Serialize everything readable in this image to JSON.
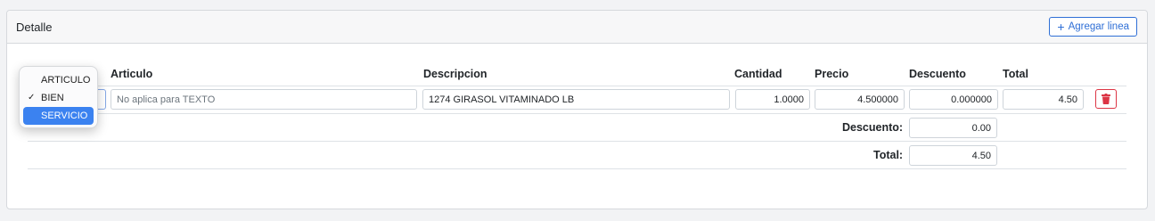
{
  "header": {
    "title": "Detalle",
    "add_button": "Agregar linea"
  },
  "table": {
    "columns": [
      "Articulo",
      "Descripcion",
      "Cantidad",
      "Precio",
      "Descuento",
      "Total"
    ],
    "rows": [
      {
        "type": "BIEN",
        "articulo_placeholder": "No aplica para TEXTO",
        "descripcion": "1274 GIRASOL VITAMINADO LB",
        "cantidad": "1.0000",
        "precio": "4.500000",
        "descuento": "0.000000",
        "total": "4.50"
      }
    ]
  },
  "type_dropdown": {
    "options": [
      "ARTICULO",
      "BIEN",
      "SERVICIO"
    ],
    "checked": "BIEN",
    "highlighted": "SERVICIO"
  },
  "summary": {
    "descuento_label": "Descuento:",
    "descuento_value": "0.00",
    "total_label": "Total:",
    "total_value": "4.50"
  },
  "colors": {
    "accent": "#2f6fd6",
    "danger": "#dc3545",
    "highlight": "#3b82f0"
  },
  "icons": {
    "add": "plus-icon",
    "delete": "trash-icon",
    "check": "checkmark-icon"
  }
}
